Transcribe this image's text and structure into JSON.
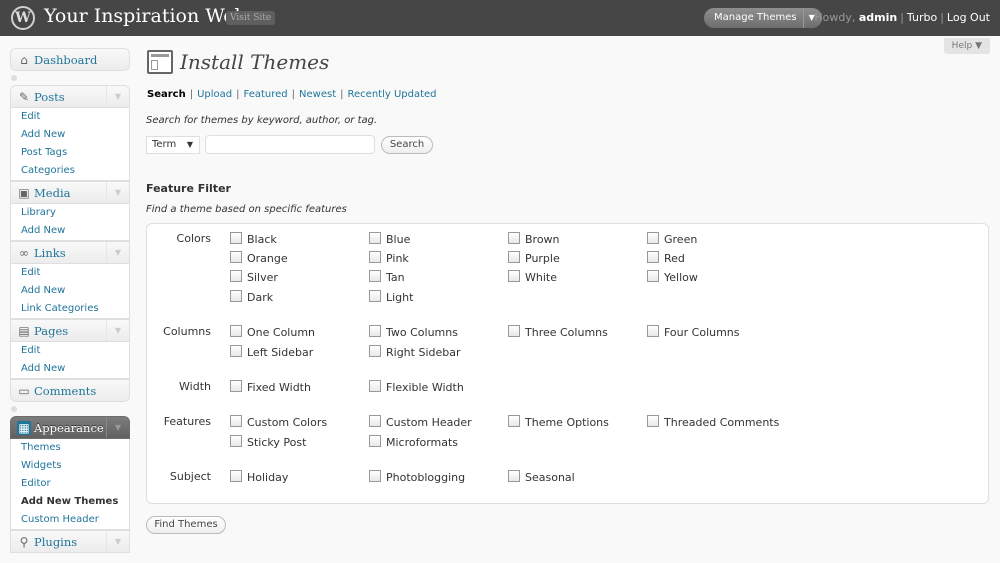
{
  "header": {
    "site_title": "Your Inspiration Web",
    "visit_site": "Visit Site",
    "fav_action": "Manage Themes",
    "howdy": "Howdy, ",
    "user": "admin",
    "turbo": "Turbo",
    "logout": "Log Out"
  },
  "help": "Help",
  "sidebar": {
    "dashboard": "Dashboard",
    "posts": {
      "label": "Posts",
      "items": [
        "Edit",
        "Add New",
        "Post Tags",
        "Categories"
      ]
    },
    "media": {
      "label": "Media",
      "items": [
        "Library",
        "Add New"
      ]
    },
    "links": {
      "label": "Links",
      "items": [
        "Edit",
        "Add New",
        "Link Categories"
      ]
    },
    "pages": {
      "label": "Pages",
      "items": [
        "Edit",
        "Add New"
      ]
    },
    "comments": "Comments",
    "appearance": {
      "label": "Appearance",
      "items": [
        "Themes",
        "Widgets",
        "Editor",
        "Add New Themes",
        "Custom Header"
      ],
      "current": "Add New Themes"
    },
    "plugins": "Plugins"
  },
  "page": {
    "title": "Install Themes",
    "tabs": [
      "Search",
      "Upload",
      "Featured",
      "Newest",
      "Recently Updated"
    ],
    "current_tab": "Search",
    "search_desc": "Search for themes by keyword, author, or tag.",
    "search_type": "Term",
    "search_value": "",
    "search_button": "Search",
    "feature_heading": "Feature Filter",
    "feature_desc": "Find a theme based on specific features",
    "find_button": "Find Themes"
  },
  "features": {
    "colors": {
      "label": "Colors",
      "options": [
        "Black",
        "Blue",
        "Brown",
        "Green",
        "Orange",
        "Pink",
        "Purple",
        "Red",
        "Silver",
        "Tan",
        "White",
        "Yellow",
        "Dark",
        "Light"
      ]
    },
    "columns": {
      "label": "Columns",
      "options": [
        "One Column",
        "Two Columns",
        "Three Columns",
        "Four Columns",
        "Left Sidebar",
        "Right Sidebar"
      ]
    },
    "width": {
      "label": "Width",
      "options": [
        "Fixed Width",
        "Flexible Width"
      ]
    },
    "features": {
      "label": "Features",
      "options": [
        "Custom Colors",
        "Custom Header",
        "Theme Options",
        "Threaded Comments",
        "Sticky Post",
        "Microformats"
      ]
    },
    "subject": {
      "label": "Subject",
      "options": [
        "Holiday",
        "Photoblogging",
        "Seasonal"
      ]
    }
  }
}
